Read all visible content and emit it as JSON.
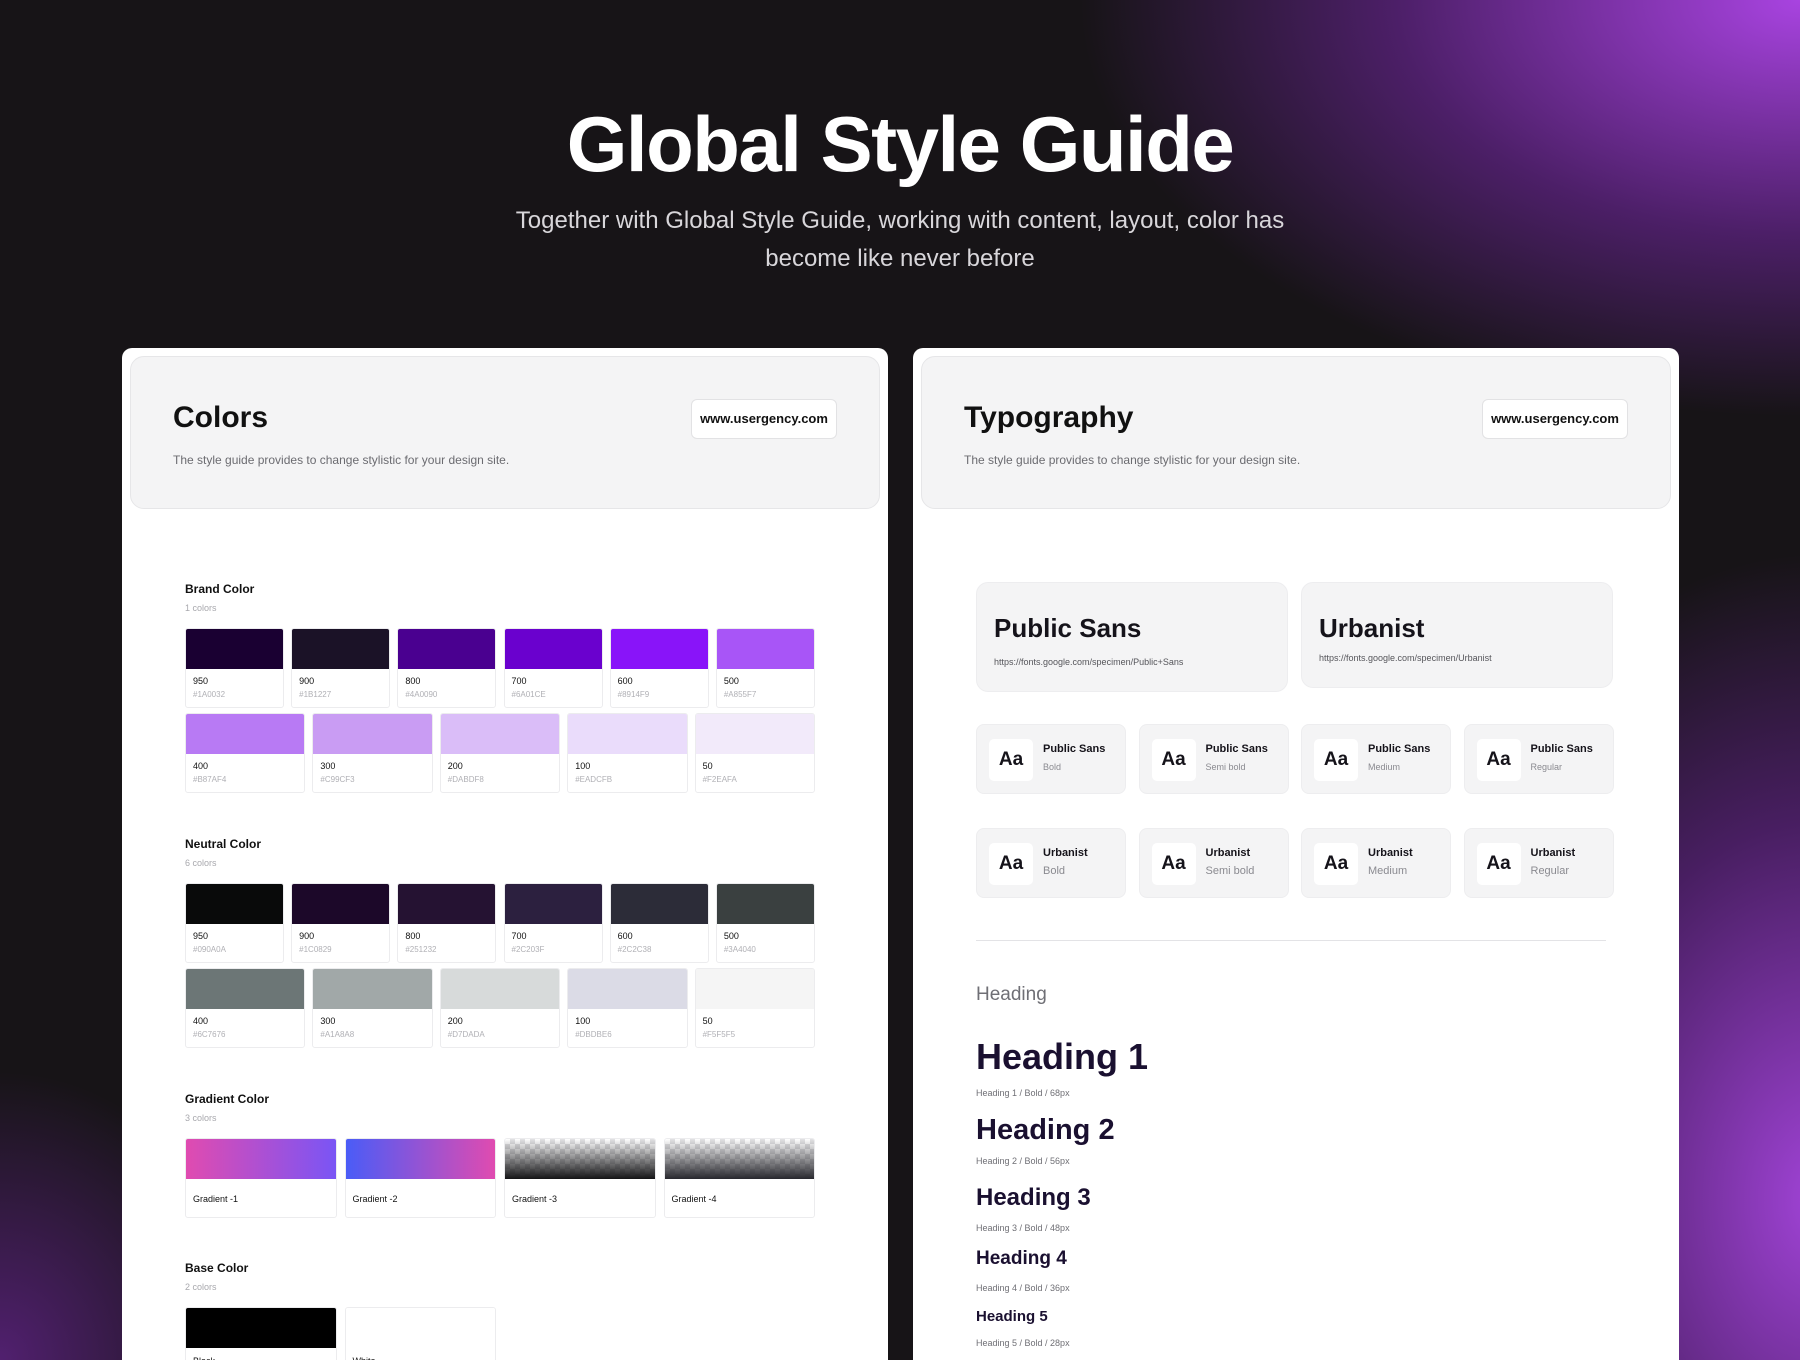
{
  "hero": {
    "title": "Global Style Guide",
    "subtitle": "Together with Global Style Guide, working with content, layout, color has become like never before"
  },
  "colors_panel": {
    "title": "Colors",
    "description": "The style guide provides to change stylistic for your design site.",
    "url": "www.usergency.com",
    "brand": {
      "title": "Brand Color",
      "count": "1 colors",
      "swatches": [
        {
          "name": "950",
          "hex": "#1A0032",
          "color": "#1A0032"
        },
        {
          "name": "900",
          "hex": "#1B1227",
          "color": "#1B1227"
        },
        {
          "name": "800",
          "hex": "#4A0090",
          "color": "#4A0090"
        },
        {
          "name": "700",
          "hex": "#6A01CE",
          "color": "#6A01CE"
        },
        {
          "name": "600",
          "hex": "#8914F9",
          "color": "#8914F9"
        },
        {
          "name": "500",
          "hex": "#A855F7",
          "color": "#A855F7"
        },
        {
          "name": "400",
          "hex": "#B87AF4",
          "color": "#B87AF4"
        },
        {
          "name": "300",
          "hex": "#C99CF3",
          "color": "#C99CF3"
        },
        {
          "name": "200",
          "hex": "#DABDF8",
          "color": "#DABDF8"
        },
        {
          "name": "100",
          "hex": "#EADCFB",
          "color": "#EADCFB"
        },
        {
          "name": "50",
          "hex": "#F2EAFA",
          "color": "#F2EAFA"
        }
      ]
    },
    "neutral": {
      "title": "Neutral Color",
      "count": "6 colors",
      "swatches": [
        {
          "name": "950",
          "hex": "#090A0A",
          "color": "#090A0A"
        },
        {
          "name": "900",
          "hex": "#1C0829",
          "color": "#1C0829"
        },
        {
          "name": "800",
          "hex": "#251232",
          "color": "#251232"
        },
        {
          "name": "700",
          "hex": "#2C203F",
          "color": "#2C203F"
        },
        {
          "name": "600",
          "hex": "#2C2C38",
          "color": "#2C2C38"
        },
        {
          "name": "500",
          "hex": "#3A4040",
          "color": "#3A4040"
        },
        {
          "name": "400",
          "hex": "#6C7676",
          "color": "#6C7676"
        },
        {
          "name": "300",
          "hex": "#A1A8A8",
          "color": "#A1A8A8"
        },
        {
          "name": "200",
          "hex": "#D7DADA",
          "color": "#D7DADA"
        },
        {
          "name": "100",
          "hex": "#DBDBE6",
          "color": "#DBDBE6"
        },
        {
          "name": "50",
          "hex": "#F5F5F5",
          "color": "#F5F5F5"
        }
      ]
    },
    "gradient": {
      "title": "Gradient Color",
      "count": "3 colors",
      "items": [
        {
          "name": "Gradient -1",
          "css": "linear-gradient(90deg, #e04bb0, #7a55f5)"
        },
        {
          "name": "Gradient -2",
          "css": "linear-gradient(90deg, #4a5cf7, #e04bb0)"
        },
        {
          "name": "Gradient -3",
          "css": "linear-gradient(180deg, rgba(20,20,22,0) 0%, #141416 100%)"
        },
        {
          "name": "Gradient -4",
          "css": "linear-gradient(180deg, rgba(40,40,46,0) 0%, #28282e 100%)"
        }
      ]
    },
    "base": {
      "title": "Base Color",
      "count": "2 colors",
      "items": [
        {
          "name": "Black",
          "color": "#000000"
        },
        {
          "name": "White",
          "color": "#FFFFFF"
        }
      ]
    }
  },
  "typography_panel": {
    "title": "Typography",
    "description": "The style guide provides to change stylistic for your design site.",
    "url": "www.usergency.com",
    "fonts": [
      {
        "name": "Public Sans",
        "url": "https://fonts.google.com/specimen/Public+Sans"
      },
      {
        "name": "Urbanist",
        "url": "https://fonts.google.com/specimen/Urbanist"
      }
    ],
    "aa": "Aa",
    "public_sans_weights": [
      {
        "font": "Public Sans",
        "weight": "Bold"
      },
      {
        "font": "Public Sans",
        "weight": "Semi bold"
      },
      {
        "font": "Public Sans",
        "weight": "Medium"
      },
      {
        "font": "Public Sans",
        "weight": "Regular"
      }
    ],
    "urbanist_weights": [
      {
        "font": "Urbanist",
        "weight": "Bold"
      },
      {
        "font": "Urbanist",
        "weight": "Semi bold"
      },
      {
        "font": "Urbanist",
        "weight": "Medium"
      },
      {
        "font": "Urbanist",
        "weight": "Regular"
      }
    ],
    "heading_label": "Heading",
    "headings": [
      {
        "text": "Heading 1",
        "caption": "Heading 1 / Bold / 68px"
      },
      {
        "text": "Heading 2",
        "caption": "Heading 2 / Bold / 56px"
      },
      {
        "text": "Heading 3",
        "caption": "Heading 3 / Bold / 48px"
      },
      {
        "text": "Heading 4",
        "caption": "Heading 4 / Bold / 36px"
      },
      {
        "text": "Heading 5",
        "caption": "Heading 5 / Bold / 28px"
      }
    ]
  }
}
